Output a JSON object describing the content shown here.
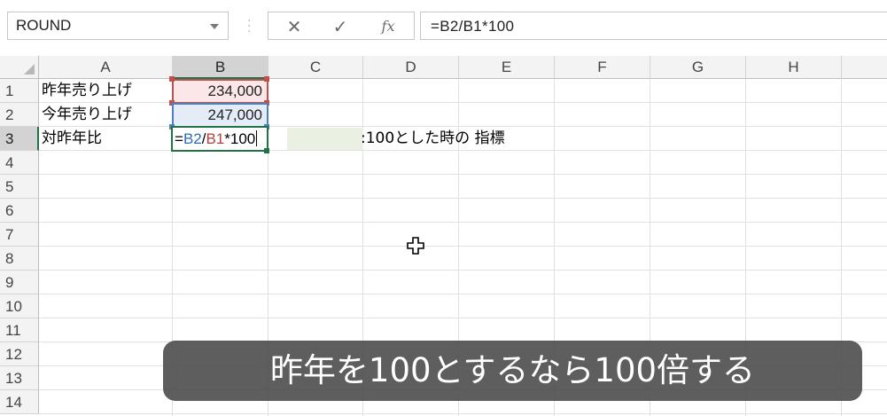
{
  "formula_bar": {
    "name_box": "ROUND",
    "cancel_icon": "✕",
    "enter_icon": "✓",
    "fx_label": "fx",
    "formula": "=B2/B1*100"
  },
  "columns": [
    "A",
    "B",
    "C",
    "D",
    "E",
    "F",
    "G",
    "H"
  ],
  "rows": [
    "1",
    "2",
    "3",
    "4",
    "5",
    "6",
    "7",
    "8",
    "9",
    "10",
    "11",
    "12",
    "13",
    "14"
  ],
  "cells": {
    "A1": "昨年売り上げ",
    "B1": "234,000",
    "A2": "今年売り上げ",
    "B2": "247,000",
    "A3": "対昨年比",
    "B3_parts": [
      "=",
      "B2",
      "/",
      "B1",
      "*100"
    ],
    "D3": ":100とした時の 指標"
  },
  "caption": "昨年を100とするなら100倍する",
  "colors": {
    "ref_b1": "#c0504d",
    "ref_b2": "#4f81bd",
    "edit_border": "#217346"
  }
}
